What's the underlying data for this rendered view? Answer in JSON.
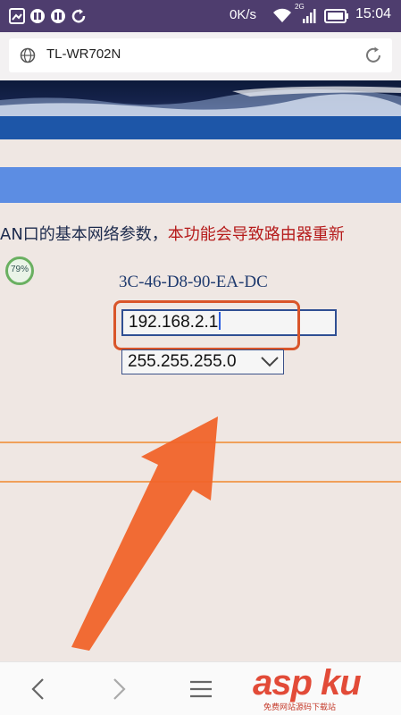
{
  "status_bar": {
    "speed": "0K/s",
    "network": "2G",
    "time": "15:04"
  },
  "address_bar": {
    "url": "TL-WR702N"
  },
  "page": {
    "desc_normal": "AN口的基本网络参数，",
    "desc_red": "本功能会导致路由器重新",
    "badge": "79%",
    "mac": "3C-46-D8-90-EA-DC",
    "ip_value": "192.168.2.1",
    "mask_value": "255.255.255.0"
  },
  "watermark": {
    "logo": "asp ku",
    "sub": "免费网站源码下载站"
  },
  "colors": {
    "status_bar": "#4e3d6e",
    "section_bar": "#5c8de3",
    "desc_red": "#b61c1c",
    "highlight": "#d9552a",
    "arrow": "#f0642a"
  }
}
